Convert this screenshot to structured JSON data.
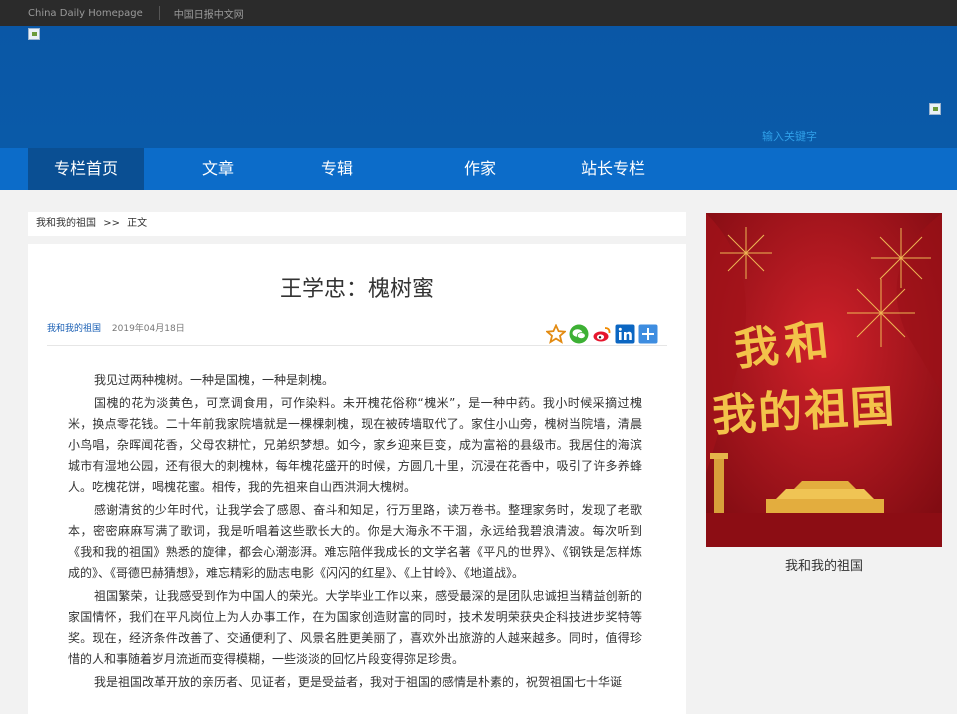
{
  "topbar": {
    "homepage_link": "China Daily Homepage",
    "cn_link": "中国日报中文网"
  },
  "search": {
    "placeholder": "输入关键字"
  },
  "nav": {
    "items": [
      "专栏首页",
      "文章",
      "专辑",
      "作家",
      "站长专栏"
    ]
  },
  "breadcrumb": {
    "section": "我和我的祖国",
    "sep": ">>",
    "current": "正文"
  },
  "article": {
    "title": "王学忠：槐树蜜",
    "source": "我和我的祖国",
    "date": "2019年04月18日",
    "paragraphs": [
      "我见过两种槐树。一种是国槐，一种是刺槐。",
      "国槐的花为淡黄色，可烹调食用，可作染料。未开槐花俗称“槐米”，是一种中药。我小时候采摘过槐米，换点零花钱。二十年前我家院墙就是一棵棵刺槐，现在被砖墙取代了。家住小山旁，槐树当院墙，清晨小鸟唱，杂晖闻花香，父母农耕忙，兄弟织梦想。如今，家乡迎来巨变，成为富裕的县级市。我居住的海滨城市有湿地公园，还有很大的刺槐林，每年槐花盛开的时候，方圆几十里，沉浸在花香中，吸引了许多养蜂人。吃槐花饼，喝槐花蜜。相传，我的先祖来自山西洪洞大槐树。",
      "感谢清贫的少年时代，让我学会了感恩、奋斗和知足，行万里路，读万卷书。整理家务时，发现了老歌本，密密麻麻写满了歌词，我是听唱着这些歌长大的。你是大海永不干涸，永远给我碧浪清波。每次听到《我和我的祖国》熟悉的旋律，都会心潮澎湃。难忘陪伴我成长的文学名著《平凡的世界》、《钢铁是怎样炼成的》、《哥德巴赫猜想》，难忘精彩的励志电影《闪闪的红星》、《上甘岭》、《地道战》。",
      "祖国繁荣，让我感受到作为中国人的荣光。大学毕业工作以来，感受最深的是团队忠诚担当精益创新的家国情怀，我们在平凡岗位上为人办事工作，在为国家创造财富的同时，技术发明荣获央企科技进步奖特等奖。现在，经济条件改善了、交通便利了、风景名胜更美丽了，喜欢外出旅游的人越来越多。同时，值得珍惜的人和事随着岁月流逝而变得模糊，一些淡淡的回忆片段变得弥足珍贵。",
      "我是祖国改革开放的亲历者、见证者，更是受益者，我对于祖国的感情是朴素的，祝贺祖国七十华诞"
    ]
  },
  "share_icons": [
    "star-icon",
    "wechat-icon",
    "weibo-icon",
    "linkedin-icon",
    "plus-icon"
  ],
  "poster": {
    "calligraphy_line1": "我和",
    "calligraphy_line2": "我的祖国",
    "caption": "我和我的祖国"
  },
  "colors": {
    "nav": "#0c6cc9",
    "nav_active": "#0a4f93",
    "banner": "#0a57a6",
    "poster_red": "#b0121b",
    "gold": "#f3c34a"
  }
}
